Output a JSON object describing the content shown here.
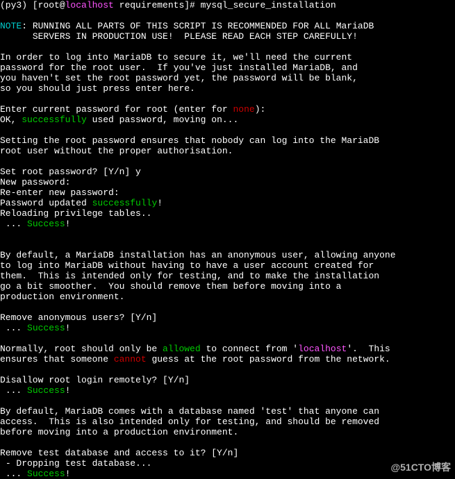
{
  "prompt": {
    "prefix": "(py3) [root@",
    "host": "localhost",
    "suffix": " requirements]# ",
    "cmd": "mysql_secure_installation"
  },
  "note_label": "NOTE",
  "note_text1": ": RUNNING ALL PARTS OF THIS SCRIPT IS RECOMMENDED FOR ALL MariaDB",
  "note_text2": "      SERVERS IN PRODUCTION USE!  PLEASE READ EACH STEP CAREFULLY!",
  "para1": "In order to log into MariaDB to secure it, we'll need the current\npassword for the root user.  If you've just installed MariaDB, and\nyou haven't set the root password yet, the password will be blank,\nso you should just press enter here.",
  "enter_pw_prefix": "Enter current password for root (enter for ",
  "none": "none",
  "enter_pw_suffix": "):",
  "ok_prefix": "OK, ",
  "successfully": "successfully",
  "ok_suffix": " used password, moving on...",
  "para2": "Setting the root password ensures that nobody can log into the MariaDB\nroot user without the proper authorisation.",
  "set_root_q": "Set root password? [Y/n] y",
  "new_pw": "New password:",
  "reenter_pw": "Re-enter new password:",
  "pw_updated_prefix": "Password updated ",
  "bang": "!",
  "reloading": "Reloading privilege tables..",
  "dots": " ... ",
  "success": "Success",
  "para3": "By default, a MariaDB installation has an anonymous user, allowing anyone\nto log into MariaDB without having to have a user account created for\nthem.  This is intended only for testing, and to make the installation\ngo a bit smoother.  You should remove them before moving into a\nproduction environment.",
  "remove_anon_q": "Remove anonymous users? [Y/n]",
  "norm_prefix": "Normally, root should only be ",
  "allowed": "allowed",
  "norm_mid": " to connect from '",
  "localhost": "localhost",
  "norm_suffix": "'.  This\nensures that someone ",
  "cannot": "cannot",
  "norm_suffix2": " guess at the root password from the network.",
  "disallow_q": "Disallow root login remotely? [Y/n]",
  "para4": "By default, MariaDB comes with a database named 'test' that anyone can\naccess.  This is also intended only for testing, and should be removed\nbefore moving into a production environment.",
  "remove_test_q": "Remove test database and access to it? [Y/n]",
  "dropping": " - Dropping test database...",
  "watermark": "@51CTO博客"
}
